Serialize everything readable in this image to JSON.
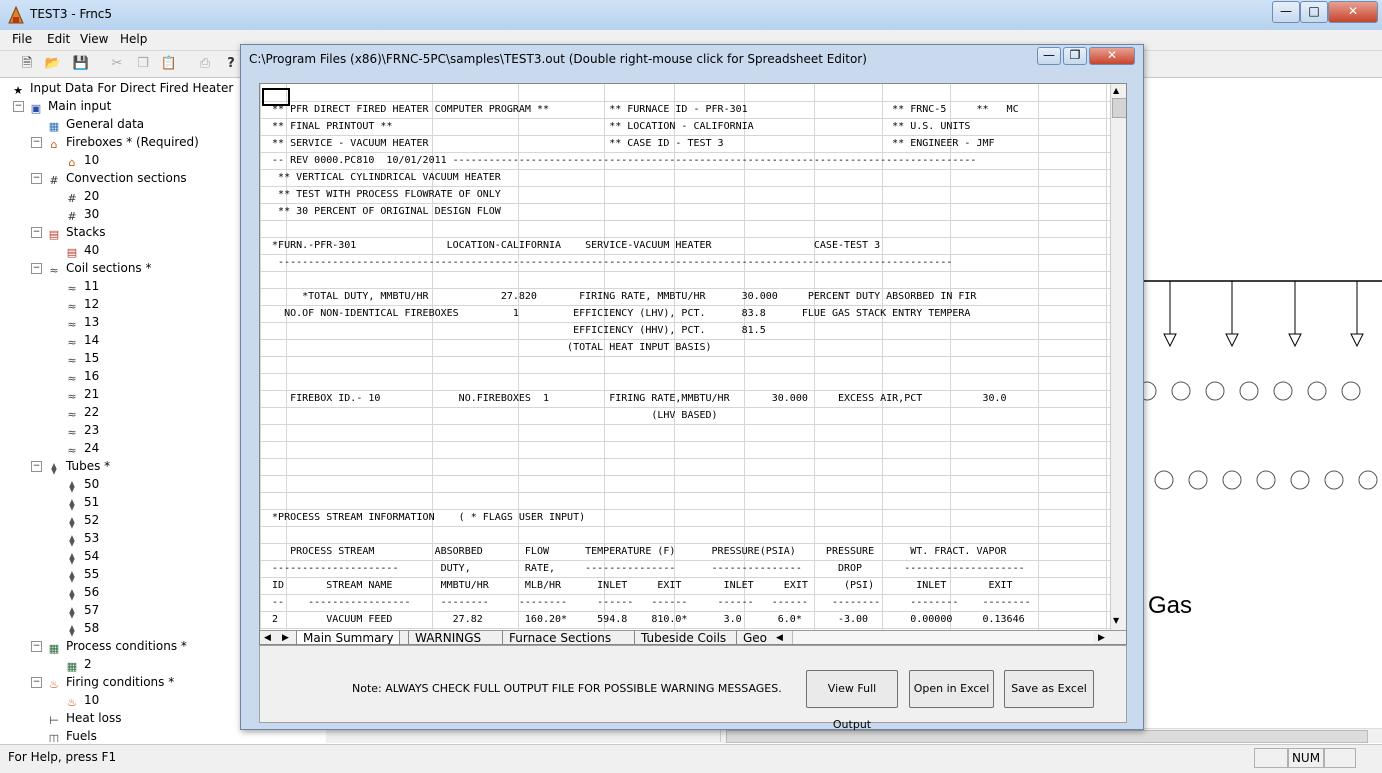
{
  "app": {
    "title": "TEST3 - Frnc5",
    "menu": [
      "File",
      "Edit",
      "View",
      "Help"
    ]
  },
  "tree": {
    "root": "Input Data For Direct Fired Heater",
    "nodes": [
      {
        "label": "Main input",
        "level": 1,
        "icon": "hierarchy-icon"
      },
      {
        "label": "General data",
        "level": 2,
        "icon": "grid-icon"
      },
      {
        "label": "Fireboxes * (Required)",
        "level": 2,
        "icon": "house-icon"
      },
      {
        "label": "10",
        "level": 3,
        "icon": "house-icon"
      },
      {
        "label": "Convection sections",
        "level": 2,
        "icon": "hash-icon"
      },
      {
        "label": "20",
        "level": 3,
        "icon": "hash-icon"
      },
      {
        "label": "30",
        "level": 3,
        "icon": "hash-icon"
      },
      {
        "label": "Stacks",
        "level": 2,
        "icon": "stack-icon"
      },
      {
        "label": "40",
        "level": 3,
        "icon": "stack-icon"
      },
      {
        "label": "Coil sections *",
        "level": 2,
        "icon": "coil-icon"
      },
      {
        "label": "11",
        "level": 3,
        "icon": "coil-icon"
      },
      {
        "label": "12",
        "level": 3,
        "icon": "coil-icon"
      },
      {
        "label": "13",
        "level": 3,
        "icon": "coil-icon"
      },
      {
        "label": "14",
        "level": 3,
        "icon": "coil-icon"
      },
      {
        "label": "15",
        "level": 3,
        "icon": "coil-icon"
      },
      {
        "label": "16",
        "level": 3,
        "icon": "coil-icon"
      },
      {
        "label": "21",
        "level": 3,
        "icon": "coil-icon"
      },
      {
        "label": "22",
        "level": 3,
        "icon": "coil-icon"
      },
      {
        "label": "23",
        "level": 3,
        "icon": "coil-icon"
      },
      {
        "label": "24",
        "level": 3,
        "icon": "coil-icon"
      },
      {
        "label": "Tubes *",
        "level": 2,
        "icon": "tube-icon"
      },
      {
        "label": "50",
        "level": 3,
        "icon": "tube-icon"
      },
      {
        "label": "51",
        "level": 3,
        "icon": "tube-icon"
      },
      {
        "label": "52",
        "level": 3,
        "icon": "tube-icon"
      },
      {
        "label": "53",
        "level": 3,
        "icon": "tube-icon"
      },
      {
        "label": "54",
        "level": 3,
        "icon": "tube-icon"
      },
      {
        "label": "55",
        "level": 3,
        "icon": "tube-icon"
      },
      {
        "label": "56",
        "level": 3,
        "icon": "tube-icon"
      },
      {
        "label": "57",
        "level": 3,
        "icon": "tube-icon"
      },
      {
        "label": "58",
        "level": 3,
        "icon": "tube-icon"
      },
      {
        "label": "Process conditions *",
        "level": 2,
        "icon": "table-icon"
      },
      {
        "label": "2",
        "level": 3,
        "icon": "table-icon"
      },
      {
        "label": "Firing conditions *",
        "level": 2,
        "icon": "flame-icon"
      },
      {
        "label": "10",
        "level": 3,
        "icon": "flame-icon"
      },
      {
        "label": "Heat loss",
        "level": 2,
        "icon": "heatloss-icon"
      },
      {
        "label": "Fuels",
        "level": 2,
        "icon": "fuel-icon"
      }
    ]
  },
  "child": {
    "title": "C:\\Program Files (x86)\\FRNC-5PC\\samples\\TEST3.out       (Double right-mouse click for Spreadsheet Editor)",
    "rows": [
      "",
      "  ** PFR DIRECT FIRED HEATER COMPUTER PROGRAM **          ** FURNACE ID - PFR-301                        ** FRNC-5     **   MC",
      "  ** FINAL PRINTOUT **                                    ** LOCATION - CALIFORNIA                       ** U.S. UNITS",
      "  ** SERVICE - VACUUM HEATER                              ** CASE ID - TEST 3                            ** ENGINEER - JMF",
      "  -- REV 0000.PC810  10/01/2011 ---------------------------------------------------------------------------------------",
      "   ** VERTICAL CYLINDRICAL VACUUM HEATER",
      "   ** TEST WITH PROCESS FLOWRATE OF ONLY",
      "   ** 30 PERCENT OF ORIGINAL DESIGN FLOW",
      "",
      "  *FURN.-PFR-301               LOCATION-CALIFORNIA    SERVICE-VACUUM HEATER                 CASE-TEST 3",
      "   ----------------------------------------------------------------------------------------------------------------",
      "",
      "       *TOTAL DUTY, MMBTU/HR            27.820       FIRING RATE, MMBTU/HR      30.000     PERCENT DUTY ABSORBED IN FIR",
      "    NO.OF NON-IDENTICAL FIREBOXES         1         EFFICIENCY (LHV), PCT.      83.8      FLUE GAS STACK ENTRY TEMPERA",
      "                                                    EFFICIENCY (HHV), PCT.      81.5",
      "                                                   (TOTAL HEAT INPUT BASIS)",
      "",
      "",
      "     FIREBOX ID.- 10             NO.FIREBOXES  1          FIRING RATE,MMBTU/HR       30.000     EXCESS AIR,PCT          30.0",
      "                                                                 (LHV BASED)",
      "",
      "",
      "",
      "",
      "",
      "  *PROCESS STREAM INFORMATION    ( * FLAGS USER INPUT)",
      "",
      "     PROCESS STREAM          ABSORBED       FLOW      TEMPERATURE (F)      PRESSURE(PSIA)     PRESSURE      WT. FRACT. VAPOR",
      "  ---------------------       DUTY,         RATE,     ---------------      ---------------      DROP       --------------------",
      "  ID       STREAM NAME        MMBTU/HR      MLB/HR      INLET     EXIT       INLET     EXIT      (PSI)       INLET       EXIT",
      "  --    -----------------     --------     --------     ------   ------     ------   ------    --------     --------    --------",
      "  2        VACUUM FEED          27.82       160.20*     594.8    810.0*      3.0      6.0*      -3.00       0.00000     0.13646"
    ],
    "tabs": [
      "Main Summary",
      "WARNINGS",
      "Furnace Sections",
      "Tubeside Coils",
      "Geo"
    ],
    "note": "Note:  ALWAYS CHECK FULL OUTPUT FILE FOR POSSIBLE WARNING MESSAGES.",
    "buttons": {
      "view_full": "View Full Output",
      "open_excel": "Open in Excel",
      "save_excel": "Save as Excel"
    }
  },
  "background": {
    "gas_label": "Gas"
  },
  "status": {
    "help": "For Help, press F1",
    "num": "NUM"
  }
}
